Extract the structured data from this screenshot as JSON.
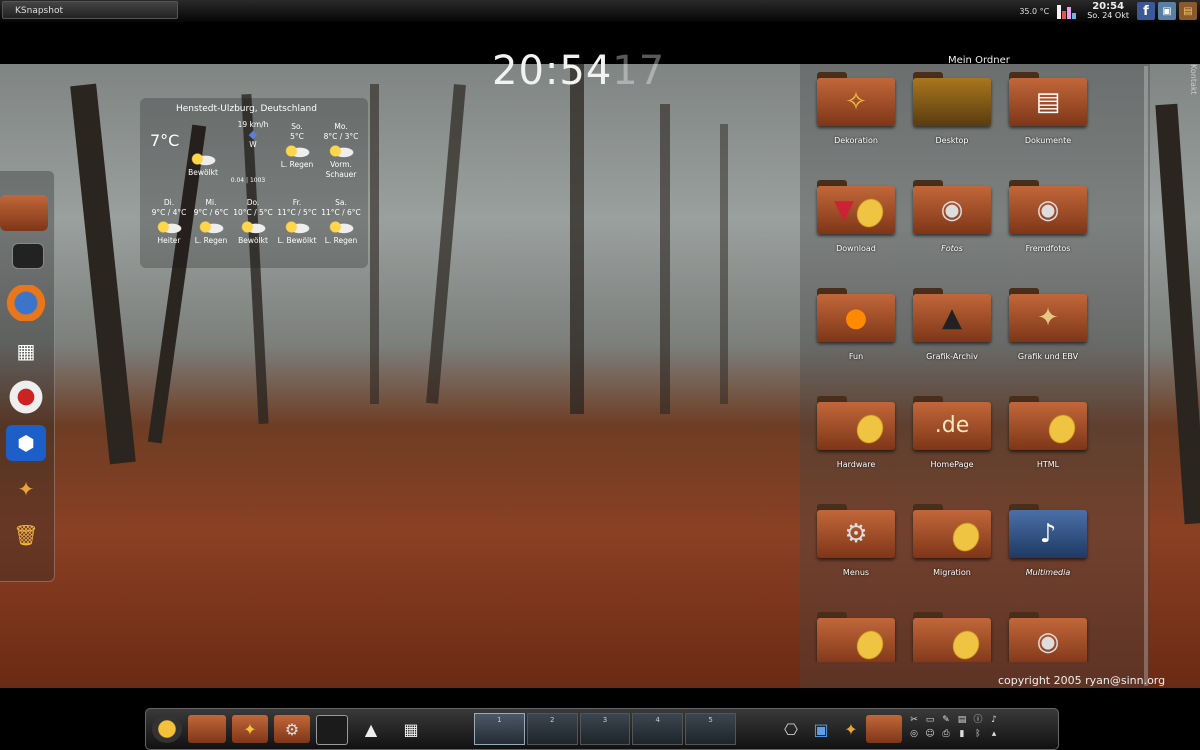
{
  "taskbar": {
    "active_window": "KSnapshot"
  },
  "top_tray": {
    "temperature": "35.0 °C",
    "clock_time": "20:54",
    "clock_date": "So. 24 Okt",
    "facebook_icon": "facebook-icon",
    "computer_icon": "computer-icon",
    "photo_icon": "photo-icon"
  },
  "big_clock": {
    "time": "20:54",
    "seconds_ghost": "17"
  },
  "weather": {
    "location": "Henstedt-Ulzburg, Deutschland",
    "current_temp": "7°C",
    "wind": "19 km/h",
    "wind_dir": "W",
    "current_cond": "Bewölkt",
    "pressure": "0.04 | 1003",
    "today": [
      {
        "day": "So.",
        "temp": "5°C",
        "cond": "L. Regen"
      },
      {
        "day": "Mo.",
        "temp": "8°C / 3°C",
        "cond": "Vorm. Schauer"
      }
    ],
    "forecast": [
      {
        "day": "Di.",
        "temp": "9°C / 4°C",
        "cond": "Heiter"
      },
      {
        "day": "Mi.",
        "temp": "9°C / 6°C",
        "cond": "L. Regen"
      },
      {
        "day": "Do.",
        "temp": "10°C / 5°C",
        "cond": "Bewölkt"
      },
      {
        "day": "Fr.",
        "temp": "11°C / 5°C",
        "cond": "L. Bewölkt"
      },
      {
        "day": "Sa.",
        "temp": "11°C / 6°C",
        "cond": "L. Regen"
      }
    ]
  },
  "folder_view": {
    "title": "Mein Ordner",
    "side_label": "Kontakt",
    "items": [
      {
        "label": "Dekoration",
        "icon": "decoration-folder-icon"
      },
      {
        "label": "Desktop",
        "icon": "desktop-folder-icon"
      },
      {
        "label": "Dokumente",
        "icon": "documents-folder-icon"
      },
      {
        "label": "Download",
        "icon": "download-folder-icon"
      },
      {
        "label": "Fotos",
        "icon": "camera-folder-icon"
      },
      {
        "label": "Fremdfotos",
        "icon": "camera-folder-icon"
      },
      {
        "label": "Fun",
        "icon": "pumpkin-folder-icon"
      },
      {
        "label": "Grafik-Archiv",
        "icon": "inkscape-folder-icon"
      },
      {
        "label": "Grafik und EBV",
        "icon": "gimp-folder-icon"
      },
      {
        "label": "Hardware",
        "icon": "leaf-folder-icon"
      },
      {
        "label": "HomePage",
        "icon": "de-folder-icon"
      },
      {
        "label": "HTML",
        "icon": "leaf-folder-icon"
      },
      {
        "label": "Menus",
        "icon": "gear-folder-icon"
      },
      {
        "label": "Migration",
        "icon": "leaf-folder-icon"
      },
      {
        "label": "Multimedia",
        "icon": "multimedia-folder-icon"
      }
    ]
  },
  "copyright": "copyright 2005  ryan@sinn.org",
  "pager": {
    "desktops": [
      "1",
      "2",
      "3",
      "4",
      "5"
    ]
  }
}
